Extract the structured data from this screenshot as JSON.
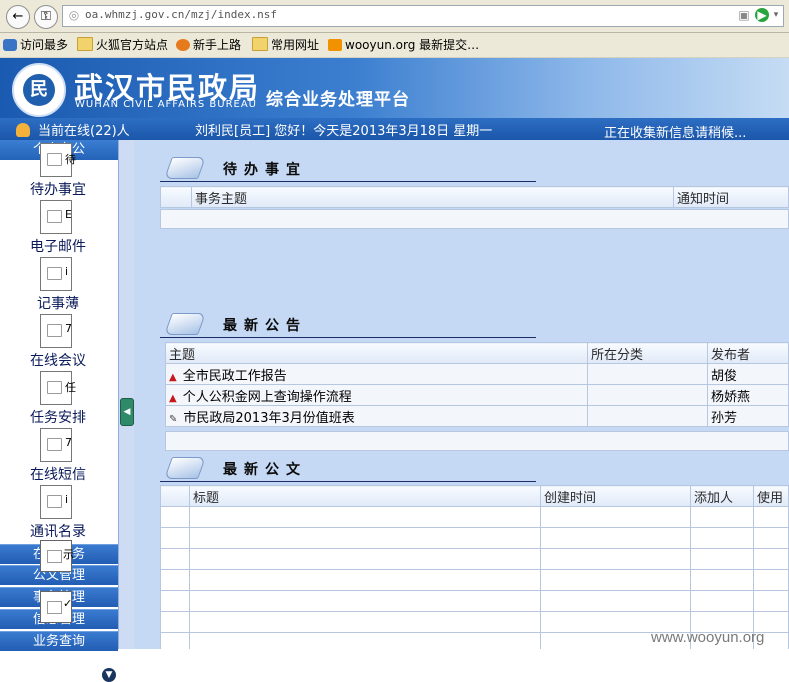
{
  "browser": {
    "url": "oa.whmzj.gov.cn/mzj/index.nsf",
    "bookmarks": [
      "访问最多",
      "火狐官方站点",
      "新手上路",
      "常用网址",
      "wooyun.org 最新提交…"
    ]
  },
  "header": {
    "logo_char": "民",
    "title_cn": "武汉市民政局",
    "title_en": "WUHAN CIVIL AFFAIRS BUREAU",
    "platform": "综合业务处理平台"
  },
  "status": {
    "online": "当前在线(22)人",
    "greeting": "刘利民[员工] 您好！今天是2013年3月18日 星期一",
    "collecting": "正在收集新信息请稍候..."
  },
  "sidebar": {
    "section_title": "个人办公",
    "items": [
      {
        "label": "待办事宜",
        "char": "待"
      },
      {
        "label": "电子邮件",
        "char": "E"
      },
      {
        "label": "记事薄",
        "char": "i"
      },
      {
        "label": "在线会议",
        "char": "7"
      },
      {
        "label": "任务安排",
        "char": "任"
      },
      {
        "label": "在线短信",
        "char": "7"
      },
      {
        "label": "通讯名录",
        "char": "i"
      }
    ],
    "categories": [
      "在线服务",
      "公文管理",
      "事务管理",
      "信息管理",
      "业务查询"
    ],
    "floating_chars": [
      "示",
      "✓"
    ]
  },
  "sections": {
    "todo": {
      "title": "待办事宜",
      "columns": [
        "",
        "事务主题",
        "通知时间"
      ]
    },
    "notices": {
      "title": "最新公告",
      "columns": [
        "主题",
        "所在分类",
        "发布者"
      ],
      "rows": [
        {
          "marker": "up",
          "topic": "全市民政工作报告",
          "category": "",
          "publisher": "胡俊"
        },
        {
          "marker": "up",
          "topic": "个人公积金网上查询操作流程",
          "category": "",
          "publisher": "杨娇燕"
        },
        {
          "marker": "doc",
          "topic": "市民政局2013年3月份值班表",
          "category": "",
          "publisher": "孙芳"
        }
      ]
    },
    "documents": {
      "title": "最新公文",
      "columns": [
        "",
        "标题",
        "创建时间",
        "添加人",
        "使用"
      ]
    }
  },
  "watermark": "www.wooyun.org",
  "colors": {
    "banner": "#1a5ab0",
    "status": "#1b56a9",
    "main_bg": "#c5d8f4",
    "accent_red": "#c8161b"
  }
}
